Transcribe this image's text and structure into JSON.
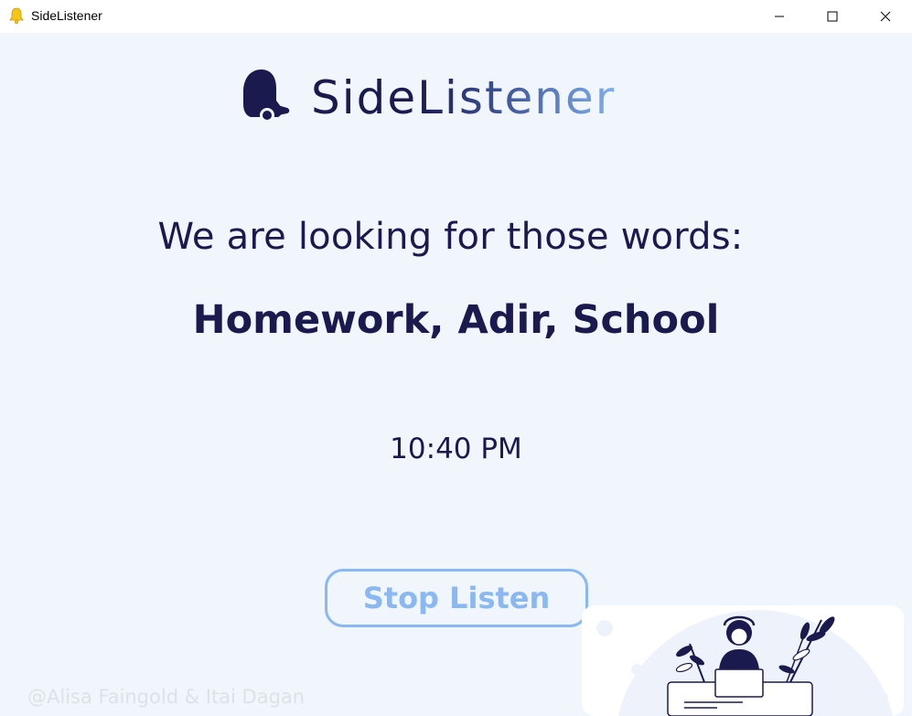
{
  "window": {
    "title": "SideListener",
    "icon": "bell-icon"
  },
  "logo": {
    "part1": "Side",
    "part2": "Listener",
    "icon": "bell-icon"
  },
  "heading": "We are looking for those words:",
  "keywords": "Homework, Adir, School",
  "time": "10:40 PM",
  "stop_button": "Stop Listen",
  "credit": "@Alisa Faingold & Itai Dagan",
  "colors": {
    "navy": "#1b1a4e",
    "light_blue": "#8ab8f2",
    "background": "#f1f6fd"
  }
}
